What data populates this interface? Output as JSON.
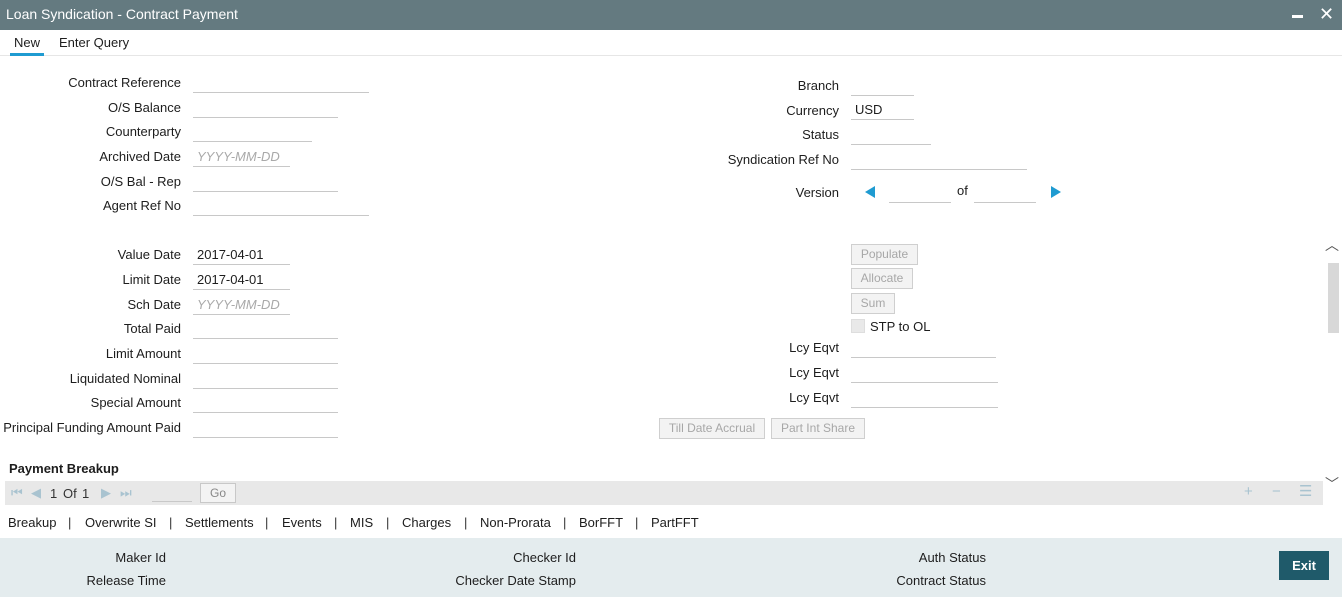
{
  "window": {
    "title": "Loan Syndication - Contract Payment"
  },
  "menu": {
    "new": "New",
    "enter_query": "Enter Query"
  },
  "left_fields": {
    "contract_reference": {
      "label": "Contract Reference",
      "value": ""
    },
    "os_balance": {
      "label": "O/S Balance",
      "value": ""
    },
    "counterparty": {
      "label": "Counterparty",
      "value": ""
    },
    "archived_date": {
      "label": "Archived Date",
      "value": "",
      "placeholder": "YYYY-MM-DD"
    },
    "os_bal_rep": {
      "label": "O/S Bal - Rep",
      "value": ""
    },
    "agent_ref_no": {
      "label": "Agent Ref No",
      "value": ""
    }
  },
  "right_fields": {
    "branch": {
      "label": "Branch",
      "value": ""
    },
    "currency": {
      "label": "Currency",
      "value": "USD"
    },
    "status": {
      "label": "Status",
      "value": ""
    },
    "syndication_ref_no": {
      "label": "Syndication Ref No",
      "value": ""
    },
    "version": {
      "label": "Version",
      "current": "",
      "of_label": "of",
      "total": ""
    }
  },
  "payment_fields": {
    "value_date": {
      "label": "Value Date",
      "value": "2017-04-01"
    },
    "limit_date": {
      "label": "Limit Date",
      "value": "2017-04-01"
    },
    "sch_date": {
      "label": "Sch Date",
      "value": "",
      "placeholder": "YYYY-MM-DD"
    },
    "total_paid": {
      "label": "Total Paid",
      "value": ""
    },
    "limit_amount": {
      "label": "Limit Amount",
      "value": ""
    },
    "liquidated_nominal": {
      "label": "Liquidated Nominal",
      "value": ""
    },
    "special_amount": {
      "label": "Special Amount",
      "value": ""
    },
    "principal_funding_amount_paid": {
      "label": "Principal Funding Amount Paid",
      "value": ""
    }
  },
  "actions": {
    "populate": "Populate",
    "allocate": "Allocate",
    "sum": "Sum",
    "stp_to_ol": "STP to OL",
    "lcy_eqvt_1": {
      "label": "Lcy Eqvt",
      "value": ""
    },
    "lcy_eqvt_2": {
      "label": "Lcy Eqvt",
      "value": ""
    },
    "lcy_eqvt_3": {
      "label": "Lcy Eqvt",
      "value": ""
    },
    "till_date_accrual": "Till Date Accrual",
    "part_int_share": "Part Int Share"
  },
  "payment_breakup": {
    "title": "Payment Breakup",
    "page_current": "1",
    "page_of": "Of",
    "page_total": "1",
    "go": "Go"
  },
  "tabs": [
    "Breakup",
    "Overwrite SI",
    "Settlements",
    "Events",
    "MIS",
    "Charges",
    "Non-Prorata",
    "BorFFT",
    "PartFFT"
  ],
  "tab_separator": "|",
  "footer": {
    "maker_id": "Maker Id",
    "release_time": "Release Time",
    "checker_id": "Checker Id",
    "checker_date_stamp": "Checker Date Stamp",
    "auth_status": "Auth Status",
    "contract_status": "Contract Status",
    "exit": "Exit"
  }
}
